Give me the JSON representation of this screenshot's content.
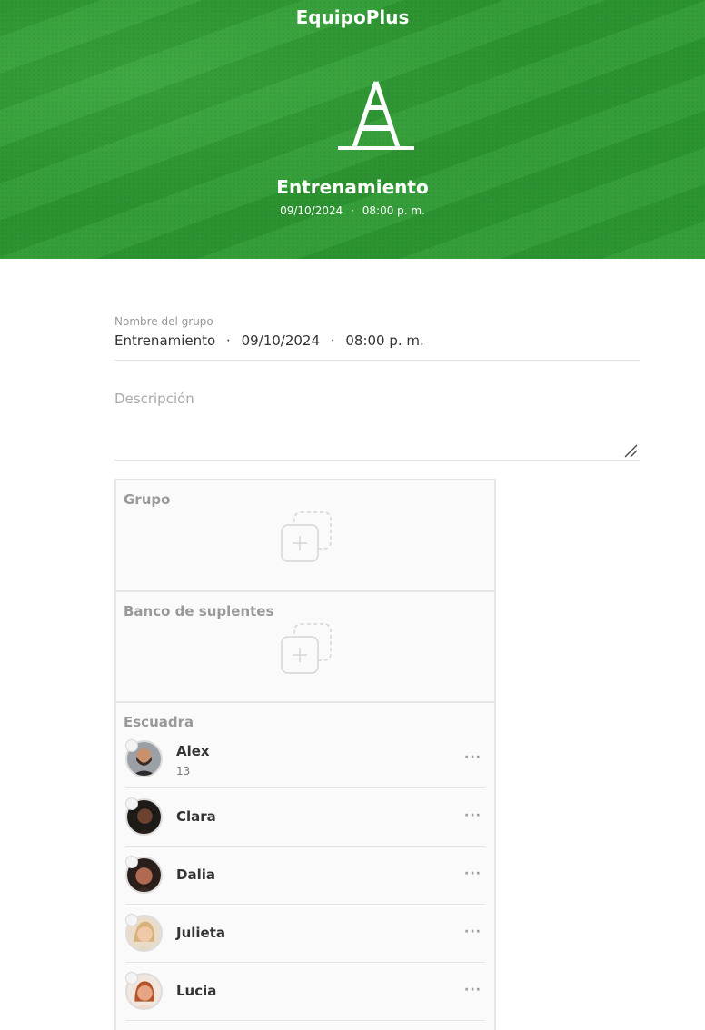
{
  "header": {
    "app_title": "EquipoPlus",
    "event_title": "Entrenamiento",
    "event_date": "09/10/2024",
    "event_time": "08:00 p. m.",
    "separator": "·",
    "brand_color": "#2f9c35"
  },
  "form": {
    "group_name_label": "Nombre del grupo",
    "group_name_value": {
      "name": "Entrenamiento",
      "date": "09/10/2024",
      "time": "08:00 p. m."
    },
    "description_placeholder": "Descripción"
  },
  "panels": {
    "group_title": "Grupo",
    "bench_title": "Banco de suplentes",
    "squad_title": "Escuadra"
  },
  "squad": [
    {
      "name": "Alex",
      "number": "13"
    },
    {
      "name": "Clara",
      "number": ""
    },
    {
      "name": "Dalia",
      "number": ""
    },
    {
      "name": "Julieta",
      "number": ""
    },
    {
      "name": "Lucia",
      "number": ""
    }
  ],
  "icons": {
    "hero": "traffic-cone-icon",
    "add": "add-stack-icon",
    "more": "more-horizontal-icon",
    "resize": "resize-handle-icon"
  },
  "more_glyph": "···"
}
